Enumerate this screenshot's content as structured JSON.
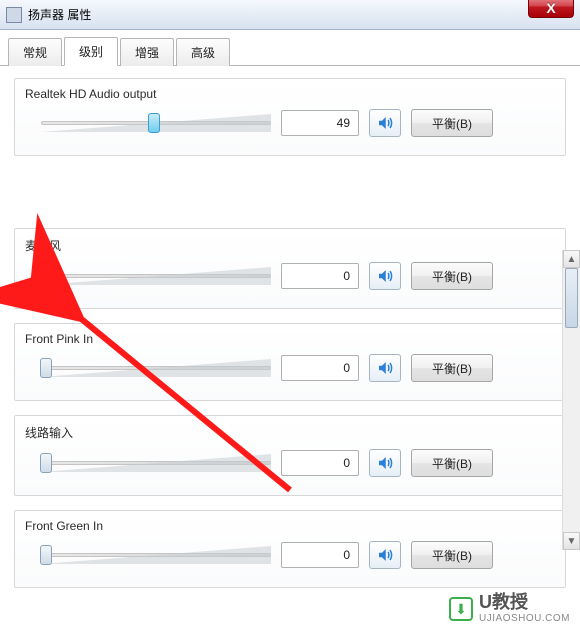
{
  "window": {
    "title": "扬声器 属性",
    "close_glyph": "X"
  },
  "tabs": [
    "常规",
    "级别",
    "增强",
    "高级"
  ],
  "active_tab_index": 1,
  "channels": [
    {
      "label": "Realtek HD Audio output",
      "value": 49,
      "thumb_pct": 49,
      "thumb_style": "blue"
    },
    {
      "label": "麦克风",
      "value": 0,
      "thumb_pct": 2,
      "thumb_style": "plain"
    },
    {
      "label": "Front Pink In",
      "value": 0,
      "thumb_pct": 2,
      "thumb_style": "plain"
    },
    {
      "label": "线路输入",
      "value": 0,
      "thumb_pct": 2,
      "thumb_style": "plain"
    },
    {
      "label": "Front Green In",
      "value": 0,
      "thumb_pct": 2,
      "thumb_style": "plain"
    }
  ],
  "balance_label": "平衡(B)",
  "watermark": {
    "brand": "U教授",
    "sub": "UJIAOSHOU.COM"
  }
}
